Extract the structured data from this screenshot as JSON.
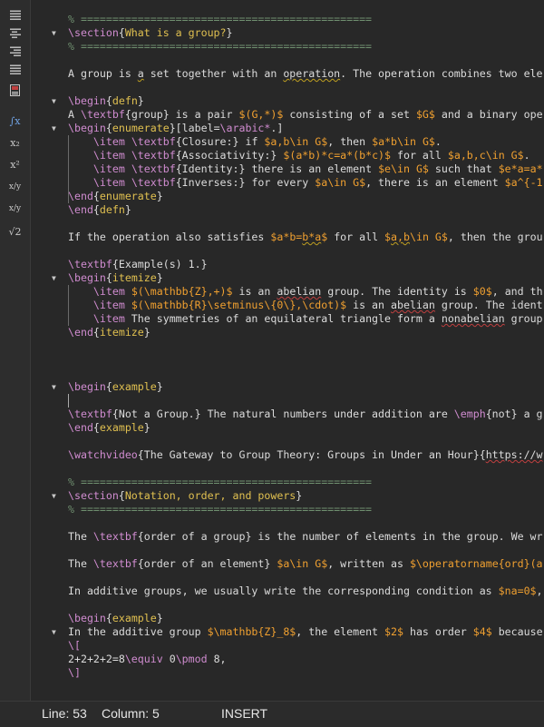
{
  "toolbar": {
    "items": [
      {
        "name": "align-left-icon"
      },
      {
        "name": "align-center-icon"
      },
      {
        "name": "align-right-icon"
      },
      {
        "name": "align-justify-icon"
      },
      {
        "name": "book-icon"
      },
      {
        "name": "integral-icon",
        "glyph": "∫x"
      },
      {
        "name": "subscript-icon",
        "glyph": "x₂"
      },
      {
        "name": "superscript-icon",
        "glyph": "x²"
      },
      {
        "name": "fraction-icon",
        "glyph": "x/y"
      },
      {
        "name": "fraction-alt-icon",
        "glyph": "x/y"
      },
      {
        "name": "square-root-icon",
        "glyph": "√2"
      }
    ]
  },
  "editor": {
    "lines": [
      "% ==============================================",
      "\\section{What is a group?}",
      "% ==============================================",
      "",
      "A group is a set together with an operation. The operation combines two ele",
      "",
      "\\begin{defn}",
      "A \\textbf{group} is a pair $(G,*)$ consisting of a set $G$ and a binary ope",
      "\\begin{enumerate}[label=\\arabic*.]",
      "    \\item \\textbf{Closure:} if $a,b\\in G$, then $a*b\\in G$.",
      "    \\item \\textbf{Associativity:} $(a*b)*c=a*(b*c)$ for all $a,b,c\\in G$.",
      "    \\item \\textbf{Identity:} there is an element $e\\in G$ such that $e*a=a*",
      "    \\item \\textbf{Inverses:} for every $a\\in G$, there is an element $a^{-1",
      "\\end{enumerate}",
      "\\end{defn}",
      "",
      "If the operation also satisfies $a*b=b*a$ for all $a,b\\in G$, then the grou",
      "",
      "\\textbf{Example(s) 1.}",
      "\\begin{itemize}",
      "    \\item $(\\mathbb{Z},+)$ is an abelian group. The identity is $0$, and th",
      "    \\item $(\\mathbb{R}\\setminus\\{0\\},\\cdot)$ is an abelian group. The ident",
      "    \\item The symmetries of an equilateral triangle form a nonabelian group",
      "\\end{itemize}",
      "",
      "",
      "",
      "\\begin{example}",
      "",
      "\\textbf{Not a Group.} The natural numbers under addition are \\emph{not} a g",
      "\\end{example}",
      "",
      "\\watchvideo{The Gateway to Group Theory: Groups in Under an Hour}{https://w",
      "",
      "% ==============================================",
      "\\section{Notation, order, and powers}",
      "% ==============================================",
      "",
      "The \\textbf{order of a group} is the number of elements in the group. We wr",
      "",
      "The \\textbf{order of an element} $a\\in G$, written as $\\operatorname{ord}(a",
      "",
      "In additive groups, we usually write the corresponding condition as $na=0$,",
      "",
      "\\begin{example}",
      "In the additive group $\\mathbb{Z}_8$, the element $2$ has order $4$ because",
      "\\[",
      "2+2+2+2=8\\equiv 0\\pmod 8,",
      "\\]"
    ]
  },
  "status": {
    "line": "Line: 53",
    "column": "Column: 5",
    "mode": "INSERT"
  }
}
